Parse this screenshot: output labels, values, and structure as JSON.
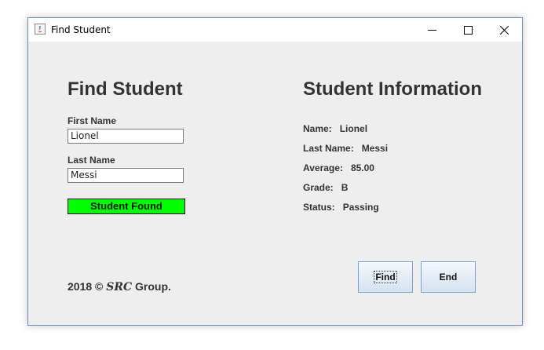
{
  "window": {
    "title": "Find Student",
    "icons": {
      "app": "java-app-icon",
      "minimize": "minimize-icon",
      "maximize": "maximize-icon",
      "close": "close-icon"
    }
  },
  "search": {
    "heading": "Find Student",
    "first_name_label": "First Name",
    "first_name_value": "Lionel",
    "last_name_label": "Last Name",
    "last_name_value": "Messi",
    "status_badge": "Student Found",
    "status_color": "#00ff00"
  },
  "info": {
    "heading": "Student Information",
    "name_label": "Name:",
    "name_value": "Lionel",
    "last_name_label": "Last Name:",
    "last_name_value": "Messi",
    "average_label": "Average:",
    "average_value": "85.00",
    "grade_label": "Grade:",
    "grade_value": "B",
    "status_label": "Status:",
    "status_value": "Passing"
  },
  "footer": {
    "year_text": "2018 ©",
    "brand": "SRC",
    "suffix": "Group."
  },
  "buttons": {
    "find": "Find",
    "end": "End"
  }
}
